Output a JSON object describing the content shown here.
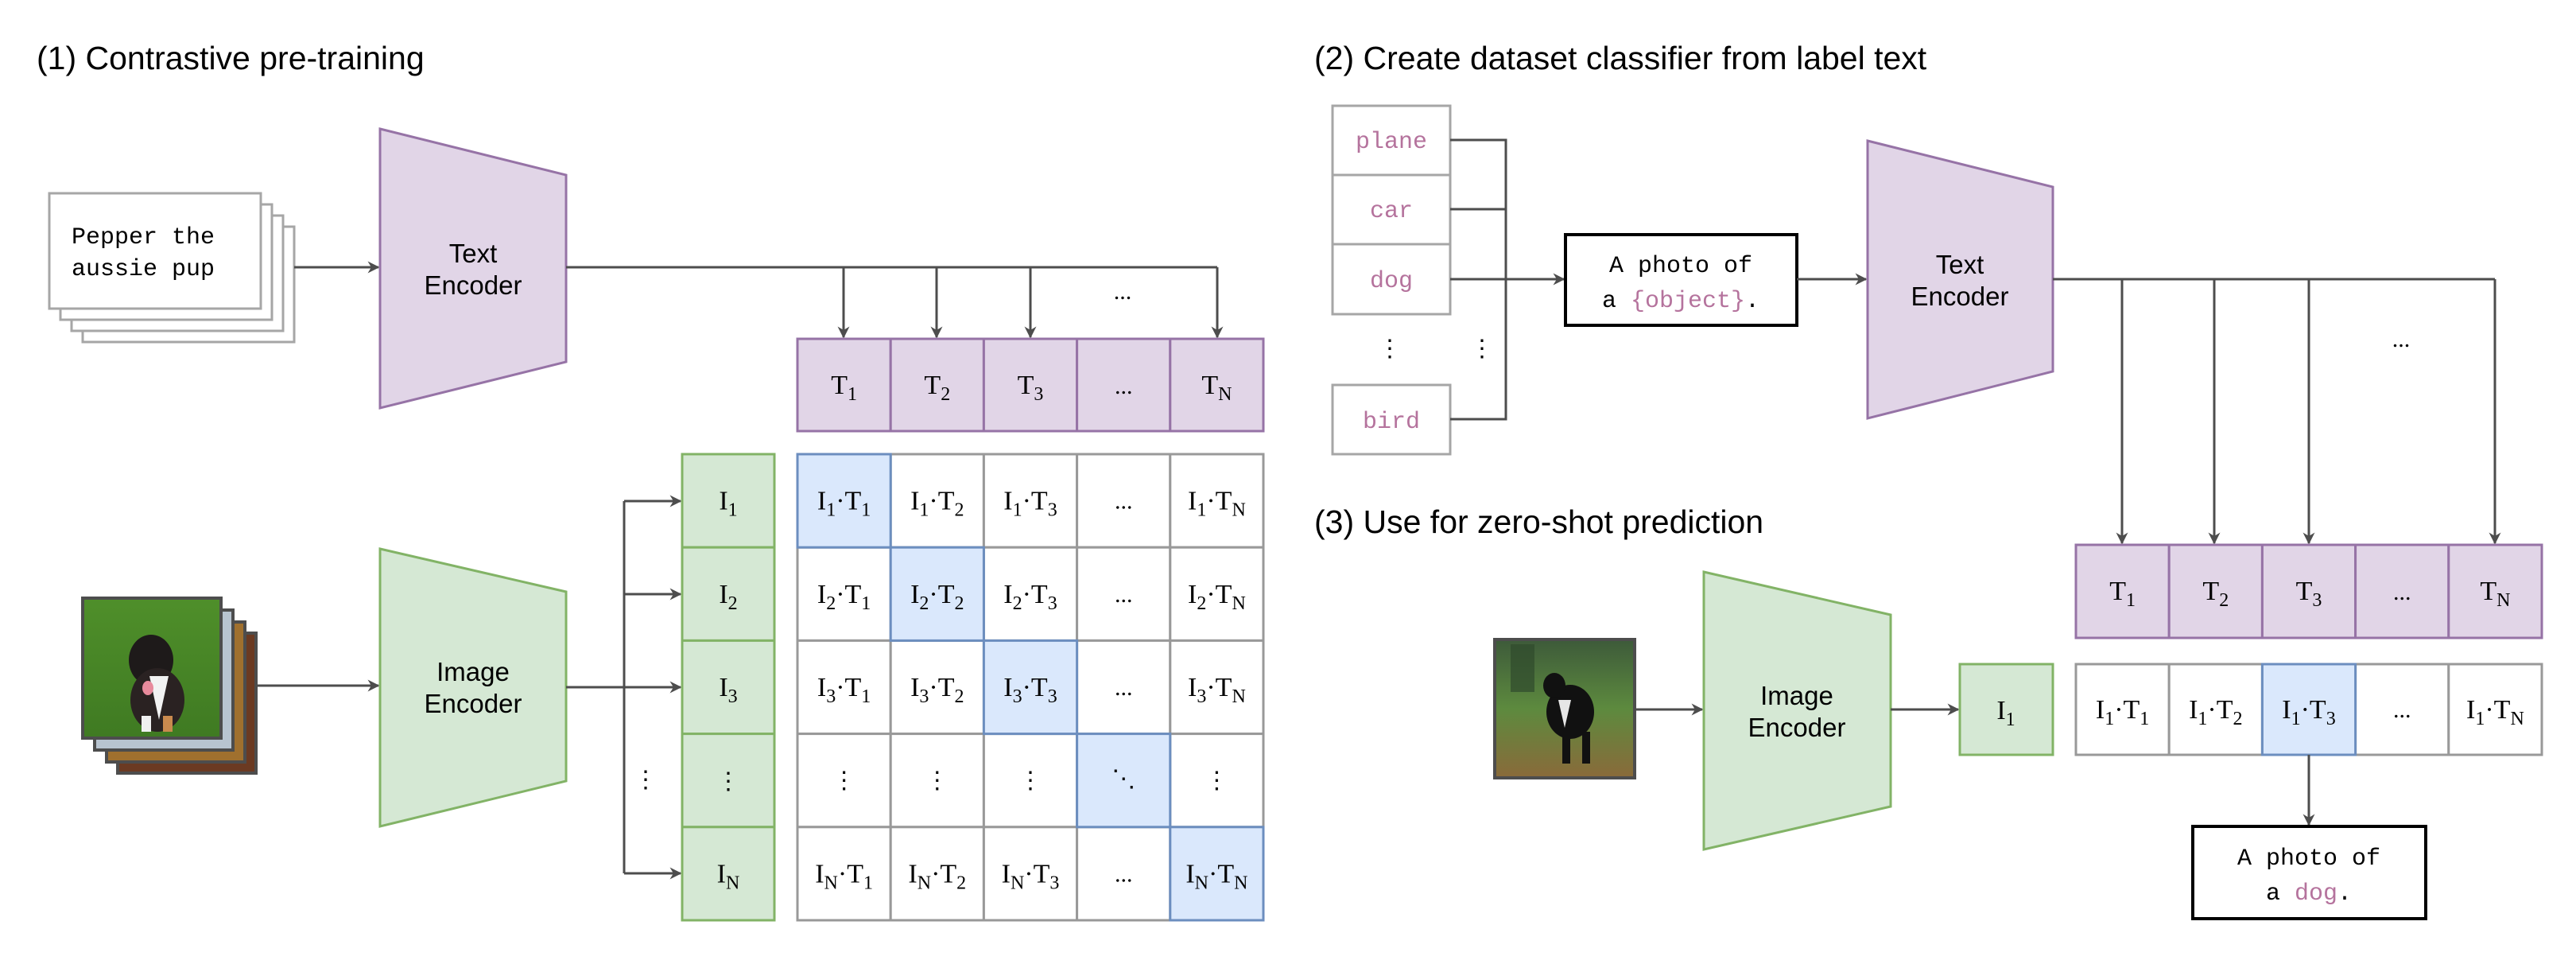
{
  "colors": {
    "text_fill": "#e1d5e7",
    "text_stroke": "#9673a6",
    "image_fill": "#d5e8d4",
    "image_stroke": "#82b366",
    "highlight_fill": "#dae8fc",
    "highlight_stroke": "#6c8ebf",
    "grid_stroke": "#999999",
    "arrow": "#4d4d4d",
    "label_pink": "#b5739d"
  },
  "section1": {
    "title": "(1) Contrastive pre-training",
    "caption_line1": "Pepper the",
    "caption_line2": "aussie pup",
    "text_encoder": [
      "Text",
      "Encoder"
    ],
    "image_encoder": [
      "Image",
      "Encoder"
    ],
    "ellipsis": "...",
    "text_embeddings": [
      {
        "base": "T",
        "sub": "1"
      },
      {
        "base": "T",
        "sub": "2"
      },
      {
        "base": "T",
        "sub": "3"
      },
      {
        "base": "...",
        "sub": ""
      },
      {
        "base": "T",
        "sub": "N"
      }
    ],
    "image_embeddings": [
      {
        "base": "I",
        "sub": "1"
      },
      {
        "base": "I",
        "sub": "2"
      },
      {
        "base": "I",
        "sub": "3"
      },
      {
        "base": "⋮",
        "sub": ""
      },
      {
        "base": "I",
        "sub": "N"
      }
    ],
    "matrix_rows": [
      "1",
      "2",
      "3",
      "⋮",
      "N"
    ],
    "matrix_cols": [
      "1",
      "2",
      "3",
      "...",
      "N"
    ],
    "vdots": "⋮",
    "ddots": "⋱"
  },
  "section2": {
    "title": "(2) Create dataset classifier from label text",
    "labels": [
      "plane",
      "car",
      "dog",
      "bird"
    ],
    "vdots": "⋮",
    "template_line1": "A photo of",
    "template_line2_prefix": "a ",
    "template_line2_object": "{object}",
    "template_line2_suffix": ".",
    "text_encoder": [
      "Text",
      "Encoder"
    ],
    "ellipsis": "...",
    "text_embeddings": [
      {
        "base": "T",
        "sub": "1"
      },
      {
        "base": "T",
        "sub": "2"
      },
      {
        "base": "T",
        "sub": "3"
      },
      {
        "base": "...",
        "sub": ""
      },
      {
        "base": "T",
        "sub": "N"
      }
    ]
  },
  "section3": {
    "title": "(3) Use for zero-shot prediction",
    "image_encoder": [
      "Image",
      "Encoder"
    ],
    "image_embedding": {
      "base": "I",
      "sub": "1"
    },
    "scores": [
      {
        "t": "1"
      },
      {
        "t": "2"
      },
      {
        "t": "3"
      },
      {
        "t": "..."
      },
      {
        "t": "N"
      }
    ],
    "highlighted_index": 2,
    "result_line1": "A photo of",
    "result_line2_prefix": "a ",
    "result_line2_object": "dog",
    "result_line2_suffix": "."
  }
}
